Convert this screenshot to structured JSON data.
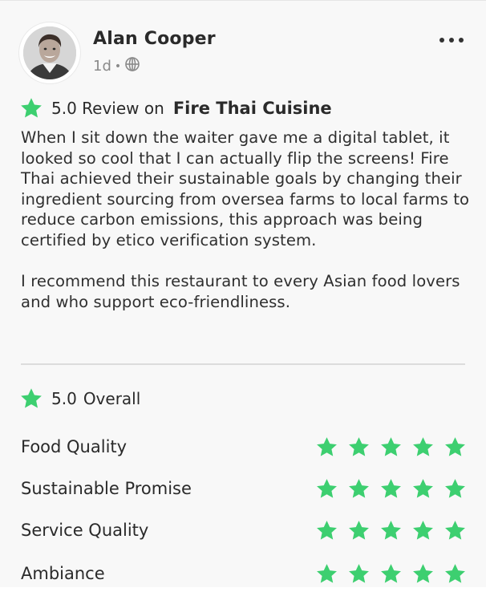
{
  "post": {
    "author": "Alan Cooper",
    "time": "1d",
    "visibility_icon": "globe-icon",
    "more_icon": "more-dots-icon"
  },
  "review": {
    "rating": "5.0",
    "review_on_label": "Review on",
    "restaurant": "Fire Thai Cuisine",
    "paragraphs": [
      "When I sit down the waiter gave me a digital tablet, it looked so cool that I can actually flip the screens! Fire Thai achieved their sustainable goals by changing their ingredient sourcing from oversea farms to local farms to reduce carbon emissions, this approach was being certified by etico verification system.",
      "I recommend this restaurant to every Asian food lovers and who support eco-friendliness."
    ]
  },
  "overall": {
    "rating": "5.0",
    "label": "Overall"
  },
  "categories": [
    {
      "label": "Food Quality",
      "stars": 5
    },
    {
      "label": "Sustainable Promise",
      "stars": 5
    },
    {
      "label": "Service Quality",
      "stars": 5
    },
    {
      "label": "Ambiance",
      "stars": 5
    }
  ],
  "colors": {
    "star": "#3dcf70",
    "text": "#2a2a2a",
    "muted": "#8a8a8a"
  }
}
